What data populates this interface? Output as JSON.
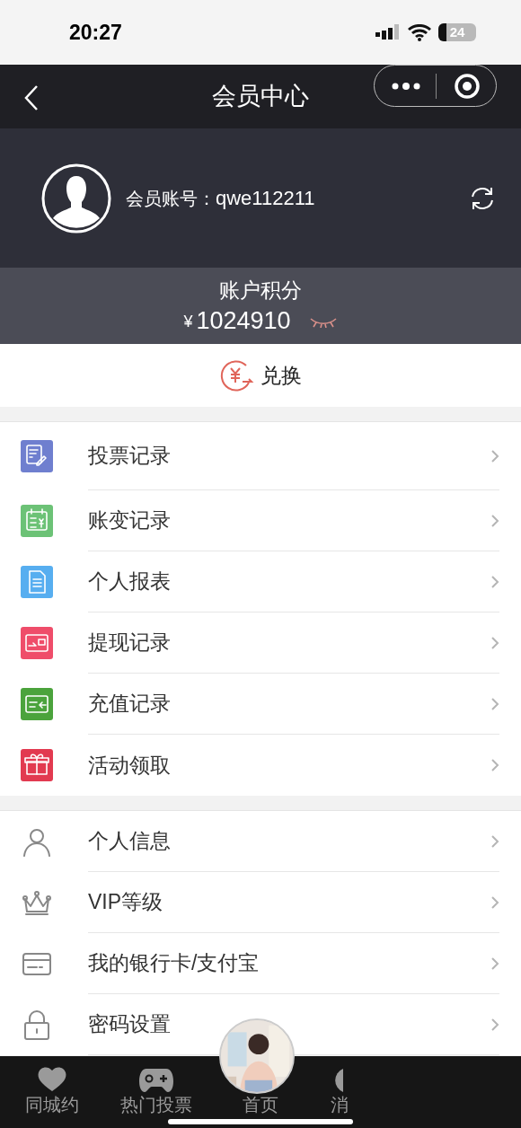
{
  "status_bar": {
    "time": "20:27",
    "battery": "24"
  },
  "nav": {
    "title": "会员中心"
  },
  "profile": {
    "account_label": "会员账号：",
    "account": "qwe112211"
  },
  "points": {
    "label": "账户积分",
    "currency": "¥",
    "amount": "1024910"
  },
  "exchange": {
    "label": "兑换"
  },
  "menu_groups": [
    [
      {
        "label": "投票记录",
        "color": "#6f7fcf"
      },
      {
        "label": "账变记录",
        "color": "#6cc276"
      },
      {
        "label": "个人报表",
        "color": "#57aef0"
      },
      {
        "label": "提现记录",
        "color": "#ef4d6a"
      },
      {
        "label": "充值记录",
        "color": "#4ba33c"
      },
      {
        "label": "活动领取",
        "color": "#e23a50"
      }
    ],
    [
      {
        "label": "个人信息"
      },
      {
        "label": "VIP等级"
      },
      {
        "label": "我的银行卡/支付宝"
      },
      {
        "label": "密码设置"
      }
    ]
  ],
  "tab_bar": [
    {
      "label": "同城约",
      "selected": false
    },
    {
      "label": "热门投票",
      "selected": false
    },
    {
      "label": "首页",
      "selected": false,
      "kind": "picture"
    },
    {
      "label": "消",
      "selected": false
    }
  ]
}
